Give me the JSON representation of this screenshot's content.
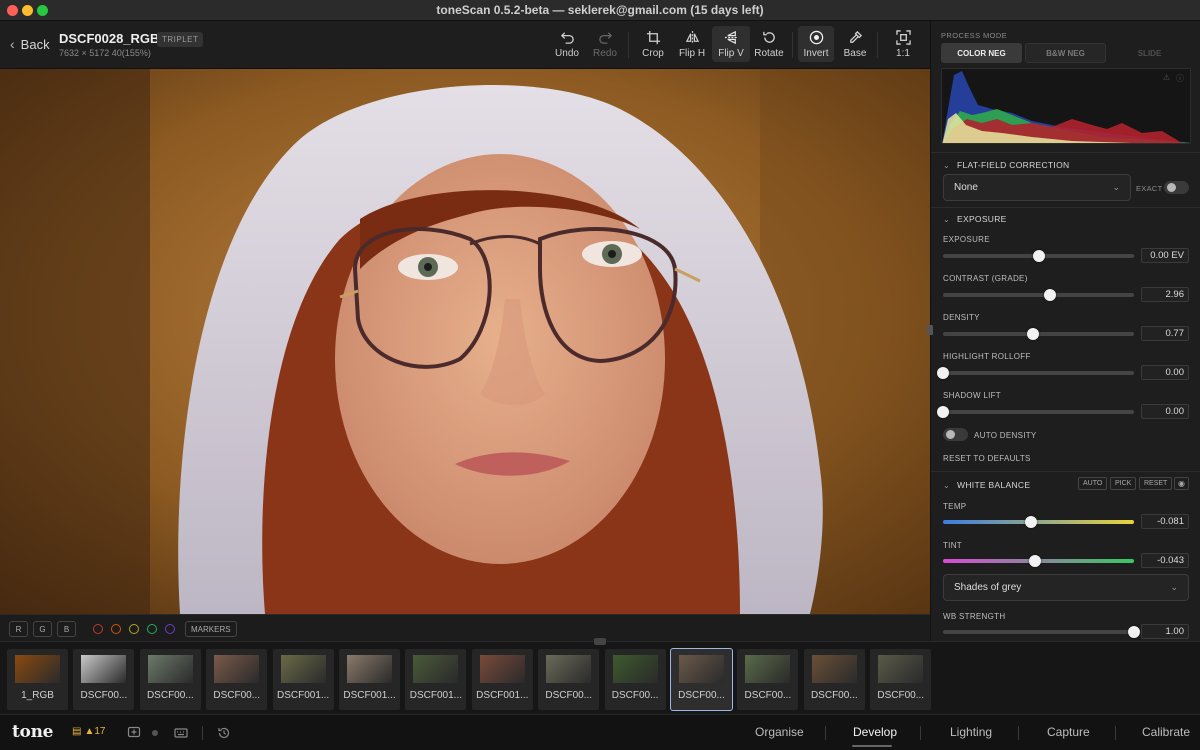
{
  "window": {
    "title": "toneScan 0.5.2-beta — seklerek@gmail.com (15 days left)"
  },
  "toolbar": {
    "back_label": "Back",
    "file_name": "DSCF0028_RGB",
    "badge": "TRIPLET",
    "dimensions": "7632 × 5172  40(155%)",
    "tools": [
      {
        "label": "Undo",
        "icon": "undo-icon"
      },
      {
        "label": "Redo",
        "icon": "redo-icon",
        "disabled": true
      },
      {
        "label": "Crop",
        "icon": "crop-icon"
      },
      {
        "label": "Flip H",
        "icon": "flip-h-icon"
      },
      {
        "label": "Flip V",
        "icon": "flip-v-icon",
        "active": true
      },
      {
        "label": "Rotate",
        "icon": "rotate-icon"
      },
      {
        "label": "Invert",
        "icon": "invert-icon",
        "active": true
      },
      {
        "label": "Base",
        "icon": "eyedropper-icon"
      },
      {
        "label": "1:1",
        "icon": "fit-icon"
      }
    ]
  },
  "channels": {
    "buttons": [
      "R",
      "G",
      "B"
    ],
    "marker_colors": [
      "#c0392b",
      "#d35400",
      "#b5a32a",
      "#27ae60",
      "#6c3fc4"
    ],
    "markers_label": "MARKERS"
  },
  "filmstrip": [
    {
      "name": "1_RGB"
    },
    {
      "name": "DSCF00..."
    },
    {
      "name": "DSCF00..."
    },
    {
      "name": "DSCF00..."
    },
    {
      "name": "DSCF001..."
    },
    {
      "name": "DSCF001..."
    },
    {
      "name": "DSCF001..."
    },
    {
      "name": "DSCF001..."
    },
    {
      "name": "DSCF00..."
    },
    {
      "name": "DSCF00..."
    },
    {
      "name": "DSCF00...",
      "selected": true
    },
    {
      "name": "DSCF00..."
    },
    {
      "name": "DSCF00..."
    },
    {
      "name": "DSCF00..."
    }
  ],
  "footer": {
    "logo": "tone",
    "warning_count": "▲17",
    "nav": [
      "Organise",
      "Develop",
      "Lighting",
      "Capture",
      "Calibrate"
    ],
    "active_nav": "Develop"
  },
  "panel": {
    "process_mode_label": "PROCESS MODE",
    "modes": [
      "COLOR NEG",
      "B&W NEG",
      "SLIDE"
    ],
    "active_mode": "COLOR NEG",
    "flat_field": {
      "title": "FLAT-FIELD CORRECTION",
      "value": "None",
      "exact_label": "EXACT",
      "exact_on": false
    },
    "exposure": {
      "title": "EXPOSURE",
      "sliders": [
        {
          "label": "EXPOSURE",
          "value": "0.00 EV",
          "position": 0.5
        },
        {
          "label": "CONTRAST (GRADE)",
          "value": "2.96",
          "position": 0.56
        },
        {
          "label": "DENSITY",
          "value": "0.77",
          "position": 0.47
        },
        {
          "label": "HIGHLIGHT ROLLOFF",
          "value": "0.00",
          "position": 0.0
        },
        {
          "label": "SHADOW LIFT",
          "value": "0.00",
          "position": 0.0
        }
      ],
      "auto_density_label": "AUTO DENSITY",
      "auto_density_on": false,
      "reset_label": "RESET TO DEFAULTS"
    },
    "white_balance": {
      "title": "WHITE BALANCE",
      "buttons": [
        "AUTO",
        "PICK",
        "RESET"
      ],
      "temp": {
        "label": "TEMP",
        "value": "-0.081",
        "position": 0.46
      },
      "tint": {
        "label": "TINT",
        "value": "-0.043",
        "position": 0.48
      },
      "preset": "Shades of grey",
      "strength": {
        "label": "WB STRENGTH",
        "value": "1.00",
        "position": 1.0
      }
    }
  }
}
